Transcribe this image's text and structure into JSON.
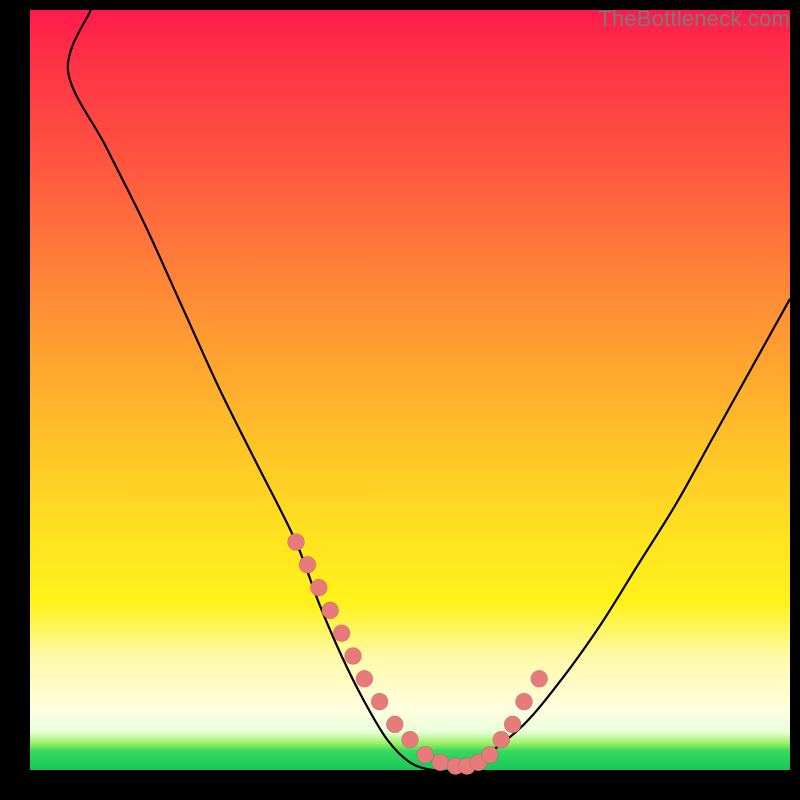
{
  "watermark": "TheBottleneck.com",
  "chart_data": {
    "type": "line",
    "title": "",
    "xlabel": "",
    "ylabel": "",
    "xlim": [
      0,
      100
    ],
    "ylim": [
      0,
      100
    ],
    "grid": false,
    "legend": false,
    "series": [
      {
        "name": "bottleneck-curve",
        "x": [
          0,
          5,
          10,
          15,
          20,
          25,
          30,
          35,
          38,
          41,
          44,
          47,
          50,
          53,
          56,
          60,
          65,
          70,
          75,
          80,
          85,
          90,
          95,
          100
        ],
        "y": [
          100,
          92,
          82,
          72,
          61,
          50,
          40,
          30,
          22,
          15,
          9,
          4,
          1,
          0,
          0,
          2,
          6,
          12,
          19,
          27,
          35,
          44,
          53,
          62
        ]
      }
    ],
    "markers": {
      "name": "sample-dots",
      "color": "#e77a7a",
      "points_x": [
        35,
        36.5,
        38,
        39.5,
        41,
        42.5,
        44,
        46,
        48,
        50,
        52,
        54,
        56,
        57.5,
        59,
        60.5,
        62,
        63.5,
        65,
        67
      ],
      "points_y": [
        30,
        27,
        24,
        21,
        18,
        15,
        12,
        9,
        6,
        4,
        2,
        1,
        0.5,
        0.5,
        1,
        2,
        4,
        6,
        9,
        12
      ]
    }
  }
}
